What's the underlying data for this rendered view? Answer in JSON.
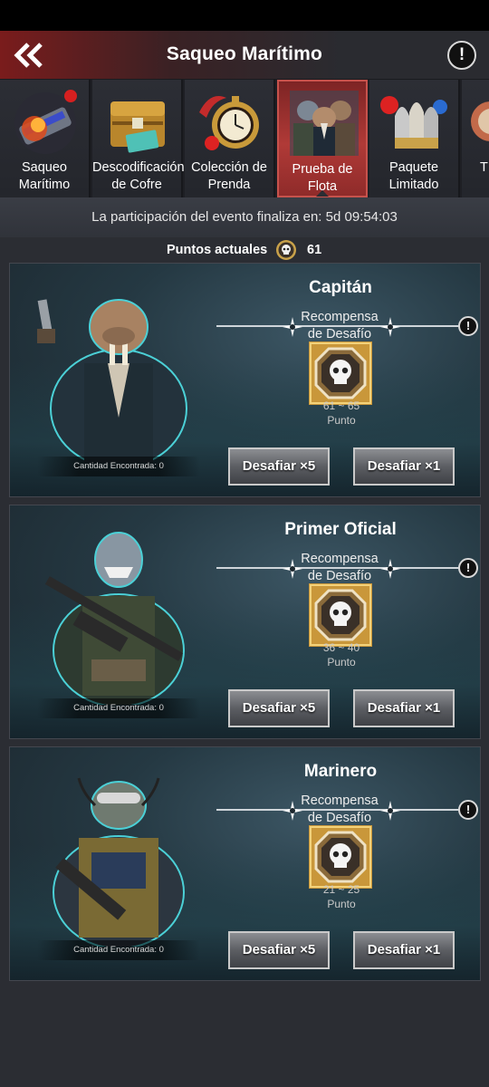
{
  "header": {
    "title": "Saqueo Marítimo"
  },
  "tabs": [
    {
      "label": "Saqueo Marítimo",
      "icon": "missile-crate-icon",
      "active": false
    },
    {
      "label": "Descodificación de Cofre",
      "icon": "treasure-chest-icon",
      "active": false
    },
    {
      "label": "Colección de Prenda",
      "icon": "pocket-watch-icon",
      "active": false
    },
    {
      "label": "Prueba de Flota",
      "icon": "pirate-crew-icon",
      "active": true
    },
    {
      "label": "Paquete Limitado",
      "icon": "bullets-icon",
      "active": false
    },
    {
      "label": "T",
      "icon": "partial-tab-icon",
      "active": false
    }
  ],
  "countdown": {
    "text": "La participación del evento finaliza en: 5d 09:54:03"
  },
  "points": {
    "label": "Puntos actuales",
    "value": "61"
  },
  "cards": [
    {
      "title": "Capitán",
      "reward_caption": "Recompensa de Desafío",
      "reward_range": "61 ~ 65",
      "reward_unit": "Punto",
      "count_text": "Cantidad Encontrada: 0",
      "btn5": "Desafiar ×5",
      "btn1": "Desafiar ×1",
      "character": "walrus-captain"
    },
    {
      "title": "Primer Oficial",
      "reward_caption": "Recompensa de Desafío",
      "reward_range": "36 ~ 40",
      "reward_unit": "Punto",
      "count_text": "Cantidad Encontrada: 0",
      "btn5": "Desafiar ×5",
      "btn1": "Desafiar ×1",
      "character": "shark-officer"
    },
    {
      "title": "Marinero",
      "reward_caption": "Recompensa de Desafío",
      "reward_range": "21 ~ 25",
      "reward_unit": "Punto",
      "count_text": "Cantidad Encontrada: 0",
      "btn5": "Desafiar ×5",
      "btn1": "Desafiar ×1",
      "character": "catfish-sailor"
    }
  ],
  "colors": {
    "accent_red": "#b03a37",
    "background": "#2b2d33",
    "gold": "#c9a24a"
  }
}
